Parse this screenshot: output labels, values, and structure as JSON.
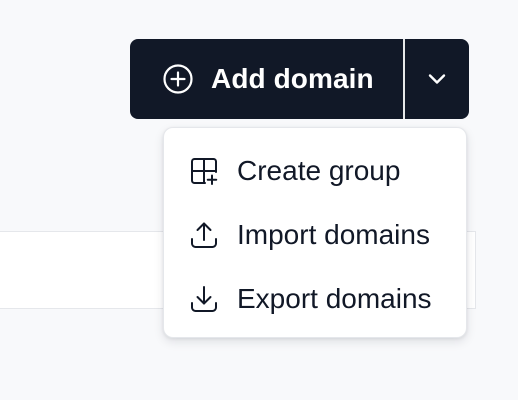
{
  "add_domain": {
    "label": "Add domain",
    "icon": "plus-circle-icon",
    "dropdown_icon": "chevron-down-icon"
  },
  "menu": {
    "items": [
      {
        "label": "Create group",
        "icon": "grid-plus-icon"
      },
      {
        "label": "Import domains",
        "icon": "upload-icon"
      },
      {
        "label": "Export domains",
        "icon": "download-icon"
      }
    ]
  },
  "colors": {
    "button_bg": "#111827",
    "button_text": "#ffffff",
    "menu_text": "#111827",
    "page_bg": "#f8f9fb"
  }
}
